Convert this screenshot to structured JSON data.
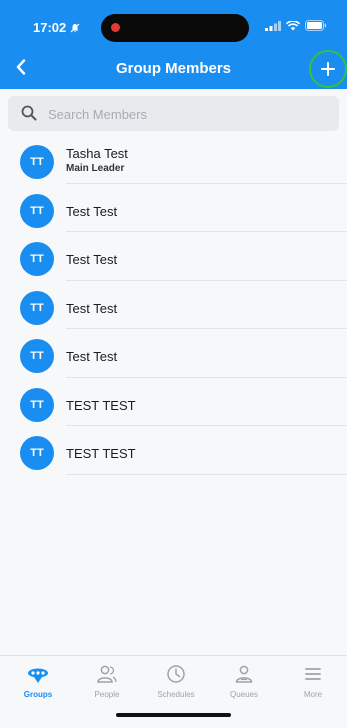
{
  "status_bar": {
    "time": "17:02"
  },
  "nav": {
    "title": "Group Members"
  },
  "search": {
    "placeholder": "Search Members"
  },
  "members": [
    {
      "initials": "TT",
      "name": "Tasha Test",
      "role": "Main Leader"
    },
    {
      "initials": "TT",
      "name": "Test Test"
    },
    {
      "initials": "TT",
      "name": "Test Test"
    },
    {
      "initials": "TT",
      "name": "Test Test"
    },
    {
      "initials": "TT",
      "name": "Test Test"
    },
    {
      "initials": "TT",
      "name": "TEST TEST"
    },
    {
      "initials": "TT",
      "name": "TEST TEST"
    }
  ],
  "tabs": [
    {
      "label": "Groups",
      "icon": "groups-icon",
      "active": true
    },
    {
      "label": "People",
      "icon": "people-icon"
    },
    {
      "label": "Schedules",
      "icon": "clock-icon"
    },
    {
      "label": "Queues",
      "icon": "queue-person-icon"
    },
    {
      "label": "More",
      "icon": "hamburger-menu-icon"
    }
  ],
  "colors": {
    "primary": "#1a8ef0",
    "highlight_ring": "#34c040"
  }
}
